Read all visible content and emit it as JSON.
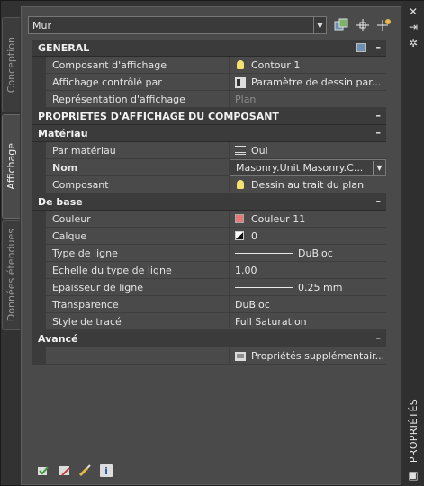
{
  "tabs": {
    "conception": "Conception",
    "affichage": "Affichage",
    "donnees": "Données étendues"
  },
  "panel_title": "PROPRIÉTÉS",
  "top": {
    "selected": "Mur"
  },
  "sections": {
    "general": "GENERAL",
    "proprietes": "PROPRIETES D'AFFICHAGE DU COMPOSANT",
    "materiau": "Matériau",
    "debase": "De base",
    "avance": "Avancé"
  },
  "general_rows": [
    {
      "label": "Composant d'affichage",
      "value": "Contour 1"
    },
    {
      "label": "Affichage contrôlé par",
      "value": "Paramètre de dessin par..."
    },
    {
      "label": "Représentation d'affichage",
      "value": "Plan"
    }
  ],
  "materiau_rows": [
    {
      "label": "Par matériau",
      "value": "Oui"
    },
    {
      "label": "Nom",
      "value": "Masonry.Unit Masonry.C..."
    },
    {
      "label": "Composant",
      "value": "Dessin au trait du plan"
    }
  ],
  "base_rows": [
    {
      "label": "Couleur",
      "value": "Couleur 11"
    },
    {
      "label": "Calque",
      "value": "0"
    },
    {
      "label": "Type de ligne",
      "value": "DuBloc"
    },
    {
      "label": "Echelle du type de ligne",
      "value": "1.00"
    },
    {
      "label": "Epaisseur de ligne",
      "value": "0.25 mm"
    },
    {
      "label": "Transparence",
      "value": "DuBloc"
    },
    {
      "label": "Style de tracé",
      "value": "Full Saturation"
    }
  ],
  "avance_rows": [
    {
      "label": "",
      "value": "Propriétés  supplémentair..."
    }
  ],
  "colors": {
    "panel": "#4a4a4a",
    "section": "#3b3b3b",
    "couleur11": "#e87878"
  }
}
